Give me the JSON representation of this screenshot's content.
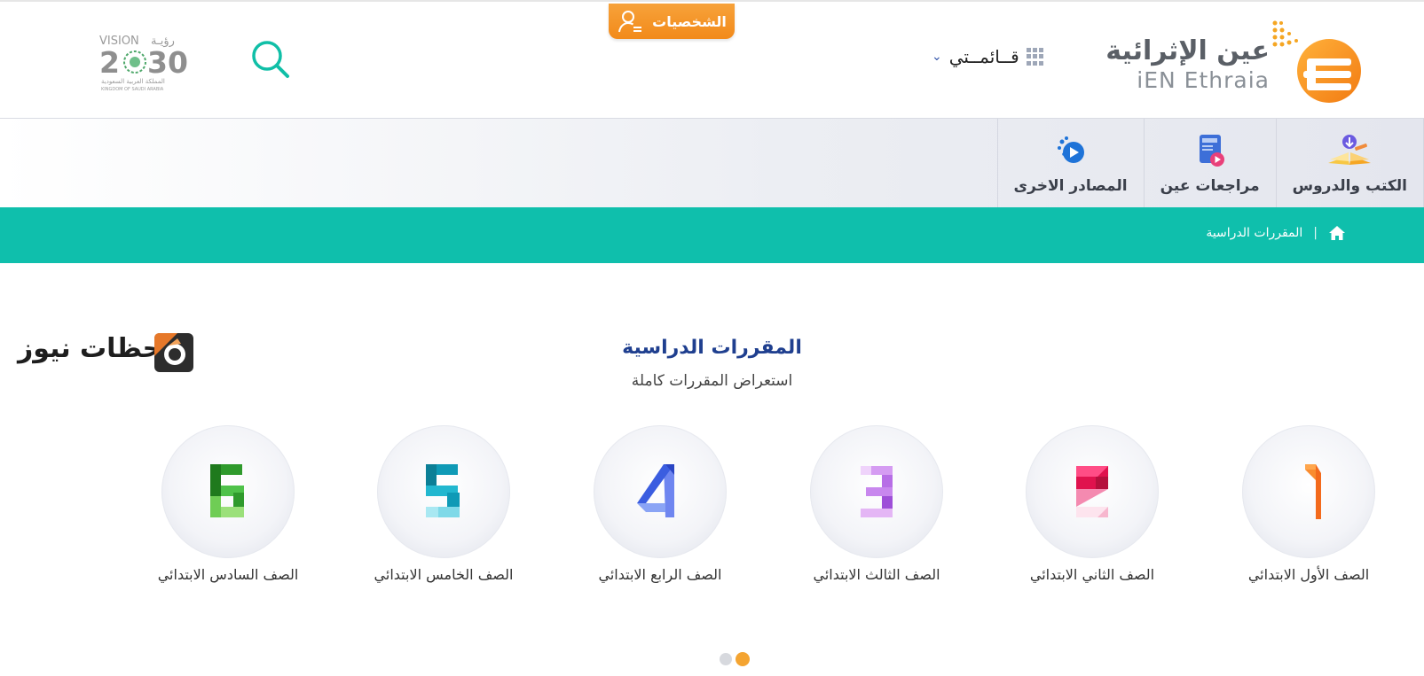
{
  "header": {
    "persons_tab": "الشخصيات",
    "brand_ar": "عين الإثرائية",
    "brand_en": "iEN Ethraia",
    "menu_label": "قــائمــتي",
    "vision": {
      "word_ar": "رؤيــة",
      "word_en": "VISION",
      "year": "2030",
      "kingdom_ar": "المملكة العربية السعودية",
      "kingdom_en": "KINGDOM OF SAUDI ARABIA"
    }
  },
  "nav": {
    "items": [
      {
        "label": "الكتب والدروس",
        "icon": "books-lessons-icon"
      },
      {
        "label": "مراجعات عين",
        "icon": "reviews-notebook-icon"
      },
      {
        "label": "المصادر الاخرى",
        "icon": "other-sources-icon"
      }
    ]
  },
  "breadcrumb": {
    "separator": "|",
    "current": "المقررات الدراسية"
  },
  "main": {
    "title": "المقررات الدراسية",
    "subtitle": "استعراض المقررات كاملة"
  },
  "watermark": {
    "text": "لحظات نيوز"
  },
  "grades": [
    {
      "label": "الصف الأول الابتدائي",
      "number": 1,
      "colors": [
        "#f36a1c",
        "#ffa64d"
      ]
    },
    {
      "label": "الصف الثاني الابتدائي",
      "number": 2,
      "colors": [
        "#e0124e",
        "#f48ab0"
      ]
    },
    {
      "label": "الصف الثالث الابتدائي",
      "number": 3,
      "colors": [
        "#b76ee6",
        "#e4b6f5"
      ]
    },
    {
      "label": "الصف الرابع الابتدائي",
      "number": 4,
      "colors": [
        "#3b5de0",
        "#8aa4f5"
      ]
    },
    {
      "label": "الصف الخامس الابتدائي",
      "number": 5,
      "colors": [
        "#0f9ab6",
        "#7fd9e8"
      ]
    },
    {
      "label": "الصف السادس الابتدائي",
      "number": 6,
      "colors": [
        "#2f9a2c",
        "#9be07a"
      ]
    }
  ],
  "pager": {
    "pages": 2,
    "active": 2
  },
  "colors": {
    "accent_teal": "#0fbfac",
    "accent_orange": "#f28a1a",
    "title_blue": "#1f3f8f"
  }
}
